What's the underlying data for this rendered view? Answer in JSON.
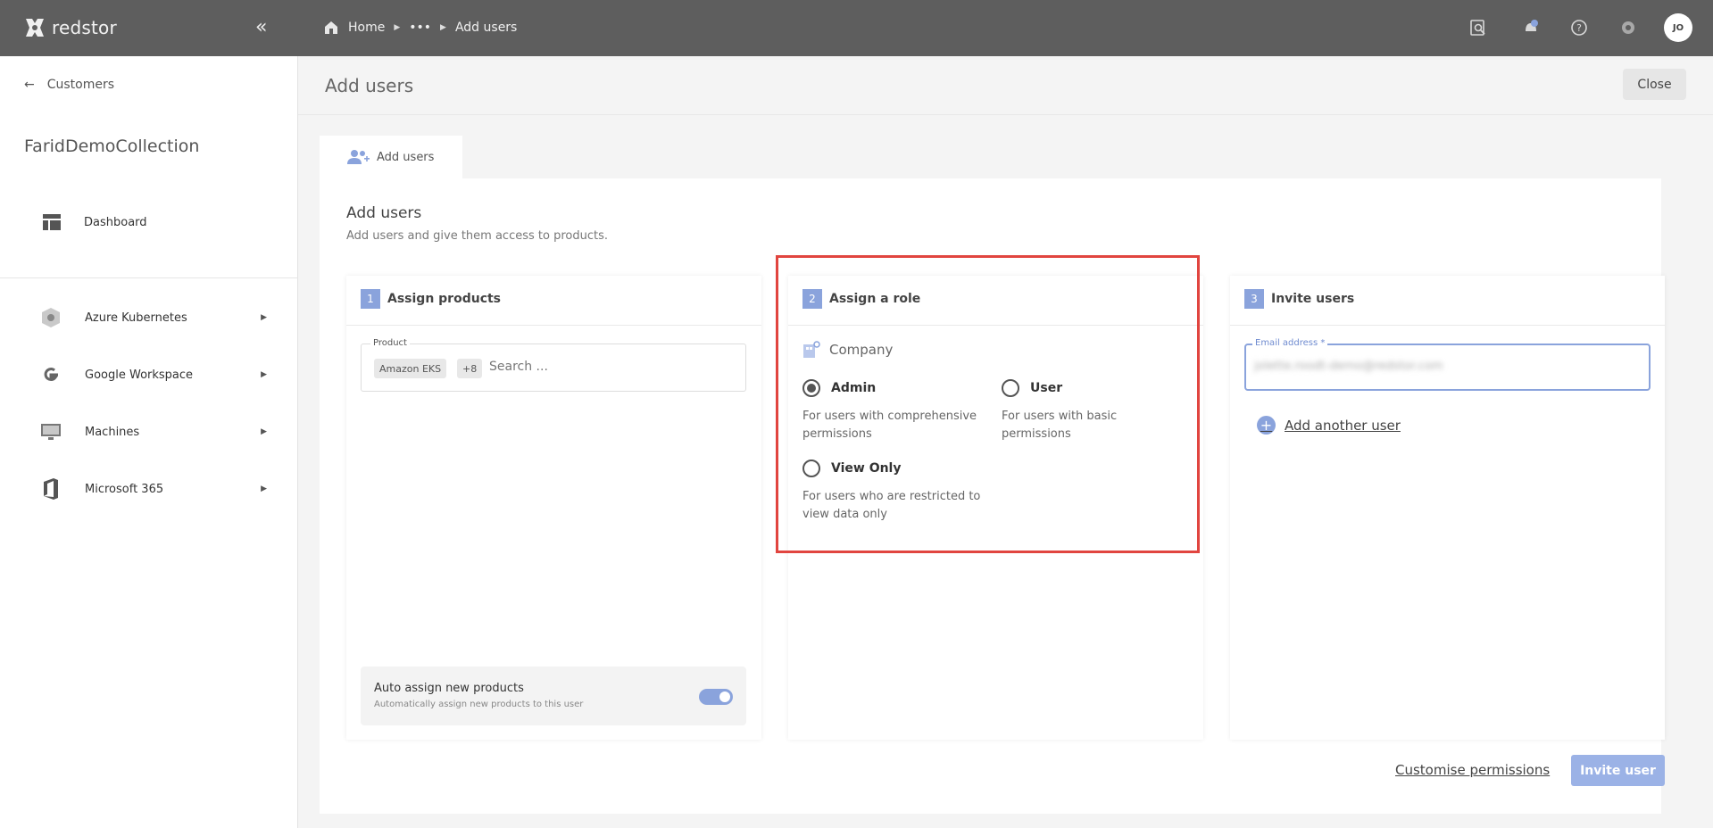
{
  "app": {
    "brand": "redstor"
  },
  "breadcrumb": {
    "home": "Home",
    "ellipsis": "•••",
    "current": "Add users"
  },
  "user": {
    "initials": "JO"
  },
  "sidebar": {
    "back_label": "Customers",
    "org_name": "FaridDemoCollection",
    "dashboard": "Dashboard",
    "items": [
      {
        "label": "Azure Kubernetes",
        "icon": "kubernetes-icon"
      },
      {
        "label": "Google Workspace",
        "icon": "google-icon"
      },
      {
        "label": "Machines",
        "icon": "monitor-icon"
      },
      {
        "label": "Microsoft 365",
        "icon": "office-icon"
      }
    ]
  },
  "page": {
    "title": "Add users",
    "close": "Close",
    "tab": "Add users"
  },
  "panel": {
    "title": "Add users",
    "subtitle": "Add users and give them access to products."
  },
  "step1": {
    "num": "1",
    "title": "Assign products",
    "product_label": "Product",
    "chips": [
      "Amazon EKS",
      "+8"
    ],
    "search_placeholder": "Search ...",
    "auto_title": "Auto assign new products",
    "auto_sub": "Automatically assign new products to this user",
    "auto_on": true
  },
  "step2": {
    "num": "2",
    "title": "Assign a role",
    "company": "Company",
    "roles": [
      {
        "label": "Admin",
        "desc": "For users with comprehensive permissions",
        "selected": true
      },
      {
        "label": "User",
        "desc": "For users with basic permissions",
        "selected": false
      },
      {
        "label": "View Only",
        "desc": "For users who are restricted to view data only",
        "selected": false
      }
    ]
  },
  "step3": {
    "num": "3",
    "title": "Invite users",
    "email_label": "Email address *",
    "email_value": "jolette.roodt-demo@redstor.com",
    "add_another": "Add another user"
  },
  "footer": {
    "customise": "Customise permissions",
    "invite": "Invite user"
  },
  "colors": {
    "accent": "#8aa3dc",
    "topbar": "#5e5e5e",
    "highlight": "#e1453f"
  }
}
